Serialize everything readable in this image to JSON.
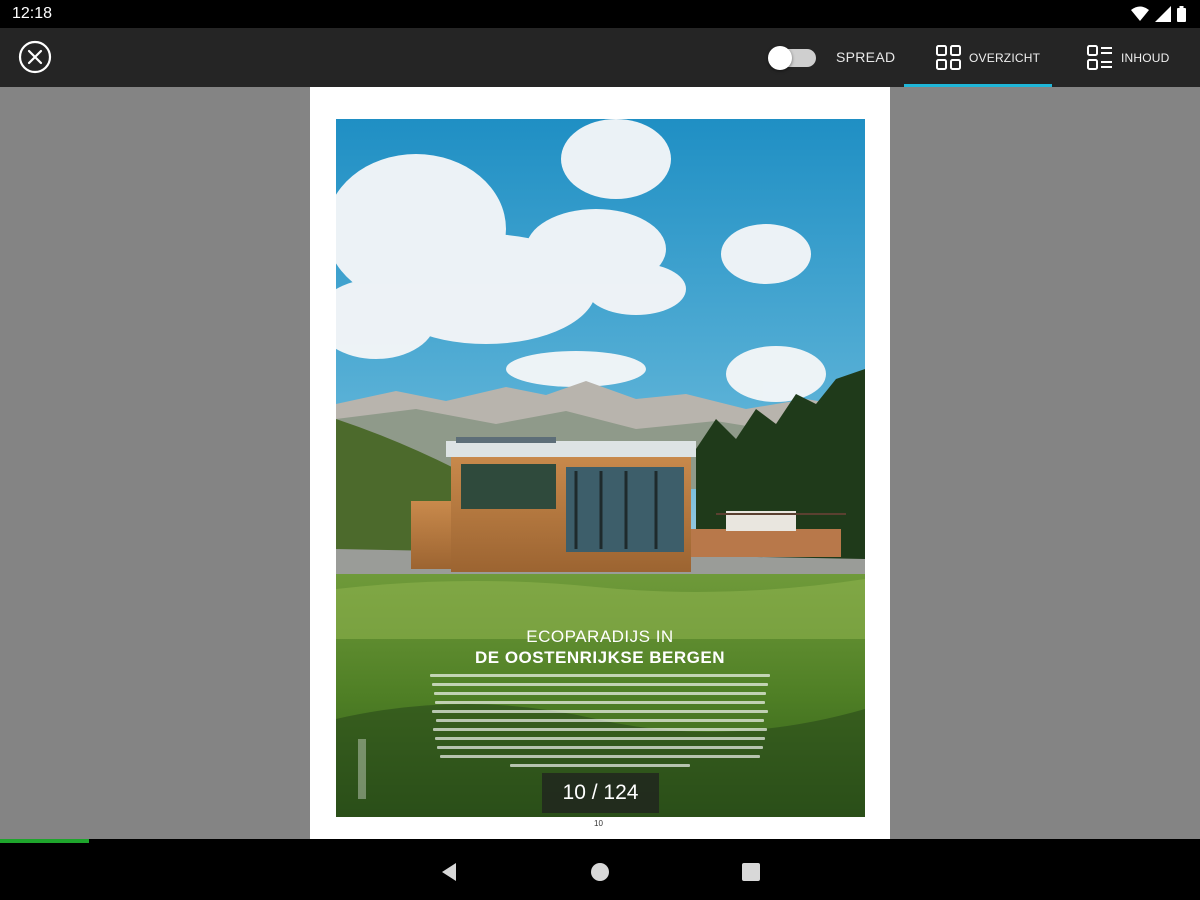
{
  "status_bar": {
    "time": "12:18",
    "icons": [
      "wifi-icon",
      "cell-signal-icon",
      "battery-icon"
    ]
  },
  "toolbar": {
    "close_icon": "close-circle-icon",
    "spread": {
      "label": "SPREAD",
      "enabled": false
    },
    "tabs": [
      {
        "label": "OVERZICHT",
        "icon": "grid-icon",
        "selected": true
      },
      {
        "label": "INHOUD",
        "icon": "list-icon",
        "selected": false
      }
    ],
    "accent_color": "#1fb6d8"
  },
  "magazine": {
    "article_kicker": "ECOPARADIJS IN",
    "article_title": "DE OOSTENRIJKSE BERGEN",
    "page_counter": "10 / 124",
    "folio": "10",
    "current_page": 10,
    "total_pages": 124
  },
  "reading_progress": {
    "fraction": 0.074,
    "color": "#1ea52c"
  },
  "nav_bar": {
    "buttons": [
      "back-icon",
      "home-icon",
      "recents-icon"
    ]
  }
}
